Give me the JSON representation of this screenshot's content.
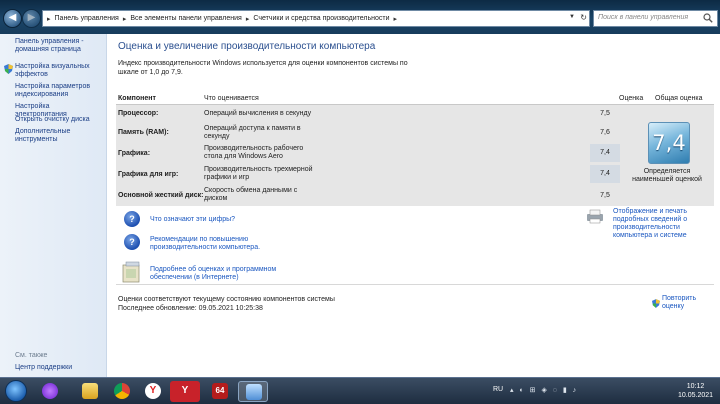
{
  "address_bar": {
    "breadcrumbs": [
      "Панель управления",
      "Все элементы панели управления",
      "Счетчики и средства производительности"
    ],
    "search_placeholder": "Поиск в панели управления"
  },
  "sidebar": {
    "items": [
      {
        "label": "Панель управления - домашняя страница"
      },
      {
        "label": "Настройка визуальных эффектов"
      },
      {
        "label": "Настройка параметров индексирования"
      },
      {
        "label": "Настройка электропитания"
      },
      {
        "label": "Открыть очистку диска"
      },
      {
        "label": "Дополнительные инструменты"
      }
    ],
    "see_also_heading": "См. также",
    "see_also_items": [
      {
        "label": "Центр поддержки"
      }
    ]
  },
  "main": {
    "title": "Оценка и увеличение производительности компьютера",
    "intro": "Индекс производительности Windows используется для оценки компонентов системы по шкале от 1,0 до 7,9.",
    "columns": {
      "component": "Компонент",
      "what": "Что оценивается",
      "score": "Оценка",
      "overall": "Общая оценка"
    },
    "rows": [
      {
        "component": "Процессор:",
        "what": "Операций вычисления в секунду",
        "score": "7,5"
      },
      {
        "component": "Память (RAM):",
        "what": "Операций доступа к памяти в секунду",
        "score": "7,6"
      },
      {
        "component": "Графика:",
        "what": "Производительность рабочего стола для Windows Aero",
        "score": "7,4"
      },
      {
        "component": "Графика для игр:",
        "what": "Производительность трехмерной графики и игр",
        "score": "7,4"
      },
      {
        "component": "Основной жесткий диск:",
        "what": "Скорость обмена данными с диском",
        "score": "7,5"
      }
    ],
    "overall_score": "7,4",
    "overall_caption": "Определяется наименьшей оценкой",
    "links": {
      "what_numbers": "Что означают эти цифры?",
      "recommendations": "Рекомендации по повышению производительности компьютера.",
      "details": "Подробнее об оценках и программном обеспечении (в Интернете)",
      "print_details": "Отображение и печать подробных сведений о производительности компьютера и системе"
    },
    "status": "Оценки соответствуют текущему состоянию компонентов системы",
    "last_update": "Последнее обновление: 09.05.2021 10:25:38",
    "rerun_label": "Повторить оценку"
  },
  "taskbar": {
    "apps": [
      "start-orb",
      "alice-assistant",
      "file-explorer",
      "chrome",
      "yandex-browser",
      "yandex-browser-pinned",
      "aida64",
      "control-panel"
    ],
    "language": "RU",
    "clock_time": "10:12",
    "clock_date": "10.05.2021"
  },
  "colors": {
    "link": "#1a57c0",
    "title": "#2a4f8f",
    "sidebar_link": "#1c3f86",
    "row_bg": "#e6e6e6"
  }
}
